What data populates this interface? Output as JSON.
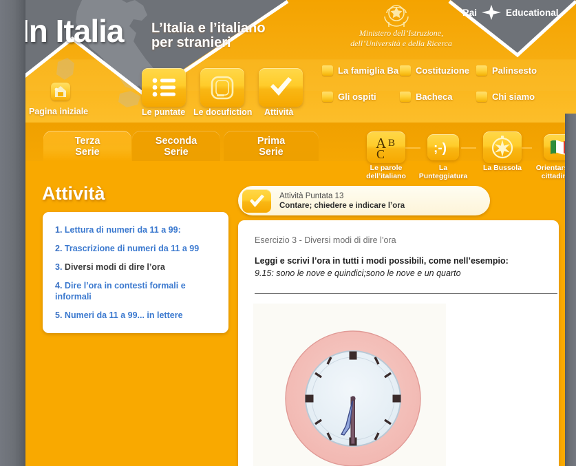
{
  "site": {
    "logo_title": "In Italia",
    "logo_subtitle_line1": "L’Italia e l’italiano",
    "logo_subtitle_line2": "per stranieri",
    "ministry_line1": "Ministero dell’Istruzione,",
    "ministry_line2": "dell’Università e della Ricerca",
    "ministry_emblem_icon": "italian-republic-emblem-icon",
    "rai_left": "Rai",
    "rai_right": "Educational",
    "rai_star_icon": "rai-star-icon",
    "italy_map_icon": "italy-map-silhouette-icon"
  },
  "colors": {
    "orange_primary": "#f9a900",
    "orange_deep": "#f4a300",
    "yellow_button": "#ffcc2a",
    "gray_frame": "#6e7278",
    "link_blue": "#3b79cf",
    "white": "#ffffff"
  },
  "main_nav": [
    {
      "label": "Pagina iniziale",
      "icon": "home-icon"
    },
    {
      "label": "Le puntate",
      "icon": "list-icon"
    },
    {
      "label": "Le docufiction",
      "icon": "tv-icon"
    },
    {
      "label": "Attività",
      "icon": "checkmark-icon"
    }
  ],
  "folder_links": [
    {
      "label": "La famiglia Ba",
      "icon": "folder-icon"
    },
    {
      "label": "Costituzione",
      "icon": "folder-icon"
    },
    {
      "label": "Palinsesto",
      "icon": "folder-icon"
    },
    {
      "label": "Gli ospiti",
      "icon": "folder-icon"
    },
    {
      "label": "Bacheca",
      "icon": "folder-icon"
    },
    {
      "label": "Chi siamo",
      "icon": "folder-icon"
    }
  ],
  "series_tabs": [
    {
      "line1": "Terza",
      "line2": "Serie",
      "active": true
    },
    {
      "line1": "Seconda",
      "line2": "Serie",
      "active": false
    },
    {
      "line1": "Prima",
      "line2": "Serie",
      "active": false
    }
  ],
  "section_buttons": [
    {
      "line1": "Le parole",
      "line2": "dell’italiano",
      "icon": "abc-icon"
    },
    {
      "line1": "La",
      "line2": "Punteggiatura",
      "icon": "winking-smiley-icon"
    },
    {
      "line1": "La Bussola",
      "line2": "",
      "icon": "compass-icon"
    },
    {
      "line1": "Orientarsi nella",
      "line2": "cittadinanza",
      "icon": "italian-flag-icon"
    }
  ],
  "left_panel": {
    "title": "Attività",
    "items": [
      {
        "num": "1.",
        "label": "Lettura di numeri da 11 a 99:",
        "current": false
      },
      {
        "num": "2.",
        "label": "Trascrizione di numeri da 11 a 99",
        "current": false
      },
      {
        "num": "3.",
        "label": "Diversi modi di dire l’ora",
        "current": true
      },
      {
        "num": "4.",
        "label": "Dire l’ora in contesti formali e informali",
        "current": false
      },
      {
        "num": "5.",
        "label": "Numeri da 11 a 99... in lettere",
        "current": false
      }
    ]
  },
  "activity_bar": {
    "icon": "checkmark-icon",
    "line1": "Attività Puntata 13",
    "line2": "Contare; chiedere e indicare l’ora"
  },
  "exercise": {
    "title": "Esercizio 3 - Diversi modi di dire l’ora",
    "instruction": "Leggi e scrivi l’ora in tutti i modi possibili, come nell’esempio:",
    "example": "9.15: sono le nove e quindici;sono le nove e un quarto",
    "image_icon": "hand-drawn-clock-illustration"
  }
}
